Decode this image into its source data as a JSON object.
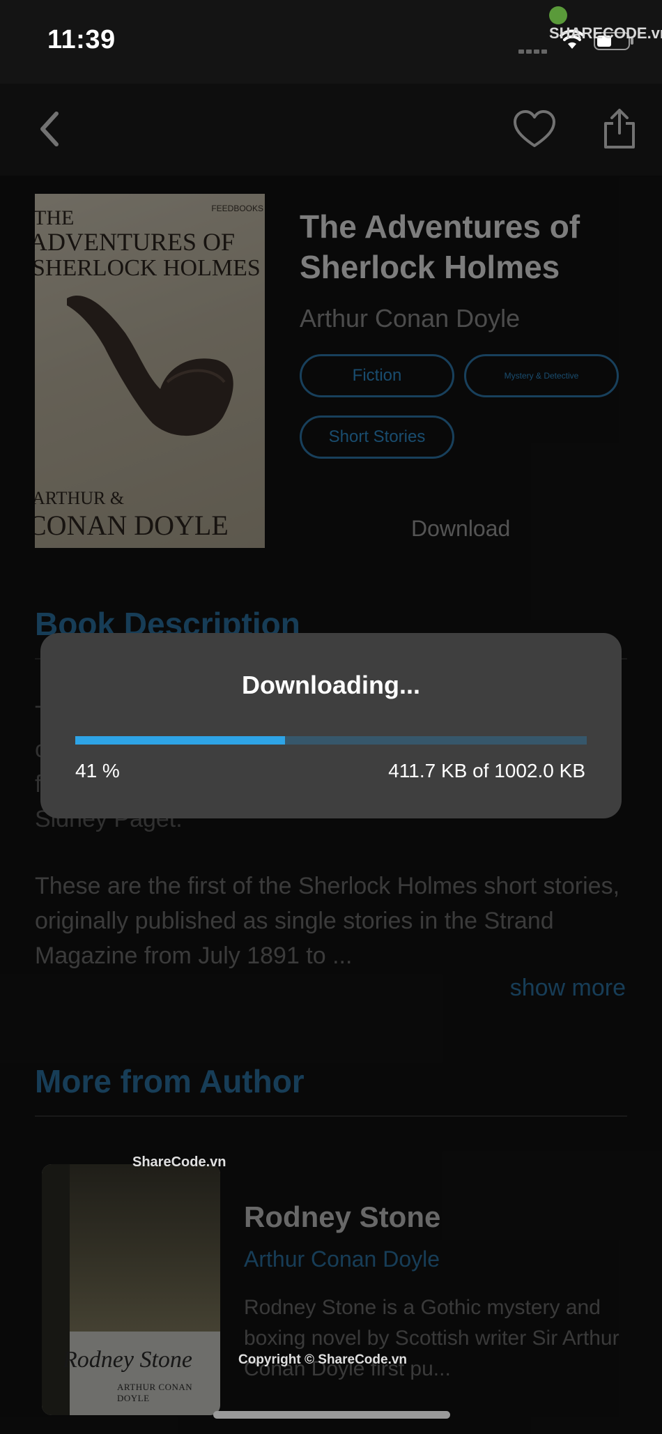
{
  "status_bar": {
    "time": "11:39"
  },
  "watermark": {
    "logo": "SHARECODE.vn",
    "mid": "ShareCode.vn",
    "bottom": "Copyright © ShareCode.vn"
  },
  "nav": {
    "back_icon": "chevron-left-icon",
    "favorite_icon": "heart-icon",
    "share_icon": "share-icon"
  },
  "book": {
    "title": "The Adventures of Sherlock Holmes",
    "author": "Arthur Conan Doyle",
    "genres": [
      "Fiction",
      "Mystery & Detective",
      "Short Stories"
    ],
    "download_label": "Download",
    "cover": {
      "line1": "THE",
      "line2": "ADVENTURES OF",
      "line3": "SHERLOCK HOLMES",
      "line4": "ARTHUR &",
      "line5": "CONAN DOYLE",
      "publisher": "FEEDBOOKS"
    }
  },
  "description": {
    "heading": "Book Description",
    "hidden_text": "T c fi Sidney Paget.",
    "paragraph": "These are the first of the Sherlock Holmes short stories, originally published as single stories in the Strand Magazine from July 1891 to ...",
    "show_more": "show more"
  },
  "more_from_author": {
    "heading": "More from Author",
    "items": [
      {
        "title": "Rodney Stone",
        "author": "Arthur Conan Doyle",
        "description": "Rodney Stone is a Gothic mystery and boxing novel by Scottish writer Sir Arthur Conan Doyle first pu...",
        "cover_title": "Rodney Stone",
        "cover_author": "ARTHUR CONAN DOYLE"
      }
    ]
  },
  "dialog": {
    "title": "Downloading...",
    "percent_label": "41 %",
    "progress": 0.41,
    "size_label": "411.7 KB of 1002.0 KB"
  },
  "colors": {
    "accent": "#2ea4e6",
    "heading": "#2a6f9e",
    "background": "#121212",
    "dialog": "#3f3f3f"
  }
}
